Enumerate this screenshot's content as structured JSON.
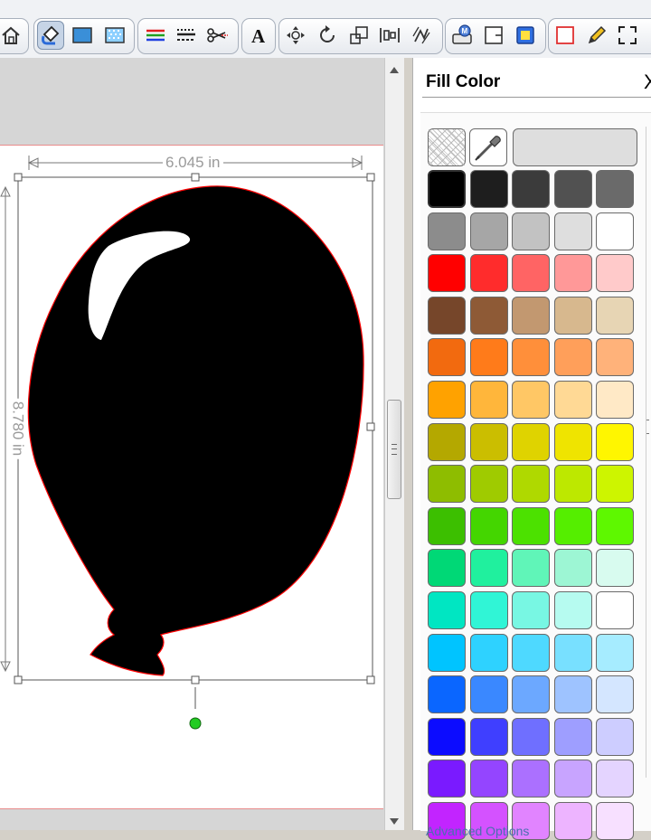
{
  "toolbar": {
    "groups": [
      {
        "buttons": [
          "home-icon"
        ]
      },
      {
        "buttons": [
          "fill-bucket-icon",
          "fill-solid-icon",
          "fill-pattern-icon"
        ]
      },
      {
        "buttons": [
          "line-color-icon",
          "line-style-icon",
          "cut-style-icon"
        ]
      },
      {
        "buttons": [
          "text-icon"
        ]
      },
      {
        "buttons": [
          "move-icon",
          "rotate-icon",
          "scale-icon",
          "align-icon",
          "replicate-icon"
        ]
      },
      {
        "buttons": [
          "send-icon",
          "add-page-icon",
          "page-setup-icon"
        ]
      },
      {
        "buttons": [
          "select-icon",
          "pencil-icon",
          "fullscreen-icon"
        ]
      }
    ]
  },
  "panel": {
    "title": "Fill Color",
    "close": "X",
    "advanced_label": "Advanced Options"
  },
  "canvas": {
    "width_label": "6.045 in",
    "height_label": "8.780 in",
    "shape": "balloon",
    "shape_fill": "#000000",
    "cut_line_color": "#ff0000",
    "rotate_handle_color": "#22cc22"
  },
  "palette": {
    "selected": "#000000",
    "rows": [
      [
        "#000000",
        "#1e1e1e",
        "#3b3b3b",
        "#515151",
        "#6a6a6a"
      ],
      [
        "#8c8c8c",
        "#a6a6a6",
        "#c2c2c2",
        "#dedede",
        "#ffffff"
      ],
      [
        "#ff0000",
        "#ff2c2c",
        "#ff6464",
        "#ff9898",
        "#ffcaca"
      ],
      [
        "#76462a",
        "#8e5a36",
        "#c29870",
        "#d7b88e",
        "#e7d5b4"
      ],
      [
        "#f26a0f",
        "#ff7b1a",
        "#ff8f3a",
        "#ff9f5a",
        "#ffb27a"
      ],
      [
        "#ffa200",
        "#ffb63b",
        "#ffc765",
        "#ffd995",
        "#ffe9c6"
      ],
      [
        "#b4a800",
        "#cbbe00",
        "#dfd300",
        "#efe400",
        "#fff600"
      ],
      [
        "#8ebd00",
        "#9fcb00",
        "#afd900",
        "#bde800",
        "#cdf500"
      ],
      [
        "#3cbf00",
        "#44d600",
        "#4ce100",
        "#55ee00",
        "#5ef800"
      ],
      [
        "#00d876",
        "#20f09e",
        "#60f5b8",
        "#9df6d4",
        "#d8fbef"
      ],
      [
        "#00e6c2",
        "#30f5d6",
        "#78f7e3",
        "#b6fbf0",
        "#ffffff"
      ],
      [
        "#00c4ff",
        "#2ed2ff",
        "#4ed9ff",
        "#78e0ff",
        "#a6ecff"
      ],
      [
        "#0a66ff",
        "#3a88ff",
        "#6ca8ff",
        "#9ec3ff",
        "#d4e6ff"
      ],
      [
        "#0c0cff",
        "#3f3fff",
        "#6f6fff",
        "#9e9eff",
        "#cdcdff"
      ],
      [
        "#7a1aff",
        "#9445ff",
        "#ab70ff",
        "#c8a4ff",
        "#e4d4ff"
      ],
      [
        "#c224ff",
        "#d452ff",
        "#e184ff",
        "#edb4ff",
        "#f7e0ff"
      ]
    ]
  }
}
